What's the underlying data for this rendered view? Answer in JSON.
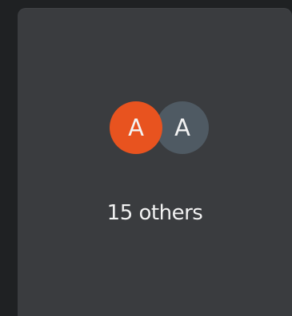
{
  "card": {
    "avatars": [
      {
        "initial": "A",
        "color": "#e8531f"
      },
      {
        "initial": "A",
        "color": "#4f5a63"
      }
    ],
    "others_text": "15 others"
  },
  "colors": {
    "background": "#1f2123",
    "card": "#3a3c3f",
    "text": "#f2f2f2"
  }
}
